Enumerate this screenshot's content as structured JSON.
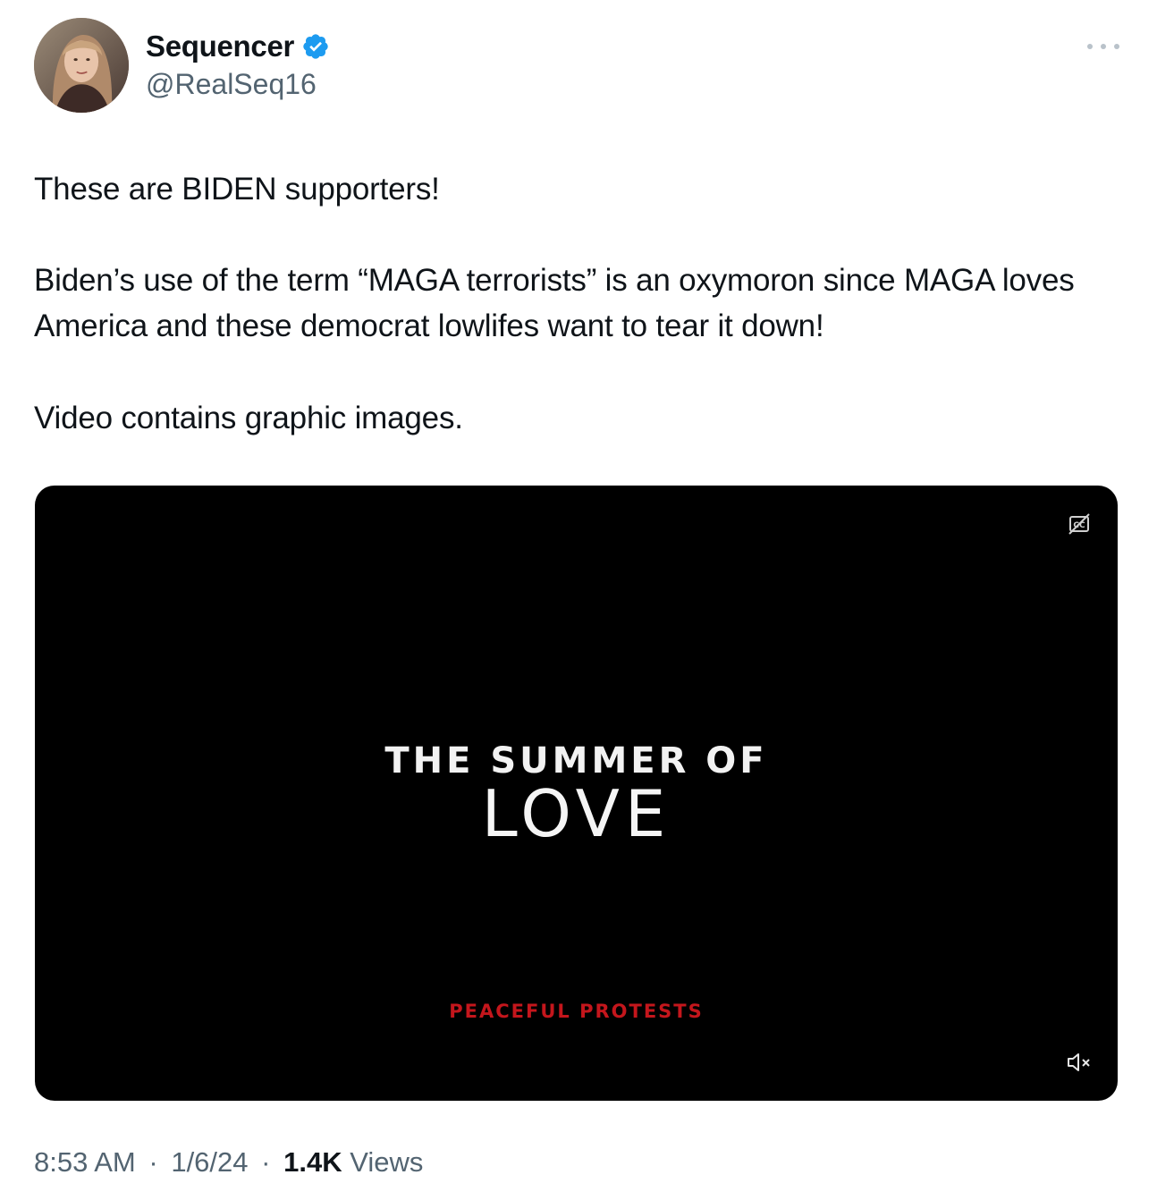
{
  "author": {
    "display_name": "Sequencer",
    "handle": "@RealSeq16",
    "verified": true,
    "avatar_icon": "profile-photo"
  },
  "tweet": {
    "paragraphs": [
      "These are BIDEN supporters!",
      "Biden’s use of the term “MAGA terrorists” is an oxymoron since MAGA loves America and these democrat lowlifes want to tear it down!",
      "Video contains graphic images."
    ]
  },
  "video": {
    "title_line1": "THE SUMMER OF",
    "title_line2": "LOVE",
    "caption": "PEACEFUL PROTESTS",
    "cc_icon": "closed-captions-icon",
    "mute_icon": "muted-speaker-icon"
  },
  "meta": {
    "time": "8:53 AM",
    "date": "1/6/24",
    "views_count": "1.4K",
    "views_label": "Views",
    "separator": "·"
  },
  "colors": {
    "text_primary": "#0f1419",
    "text_secondary": "#536471",
    "verified_badge": "#1d9bf0",
    "video_background": "#000000",
    "video_caption": "#c4161c"
  }
}
